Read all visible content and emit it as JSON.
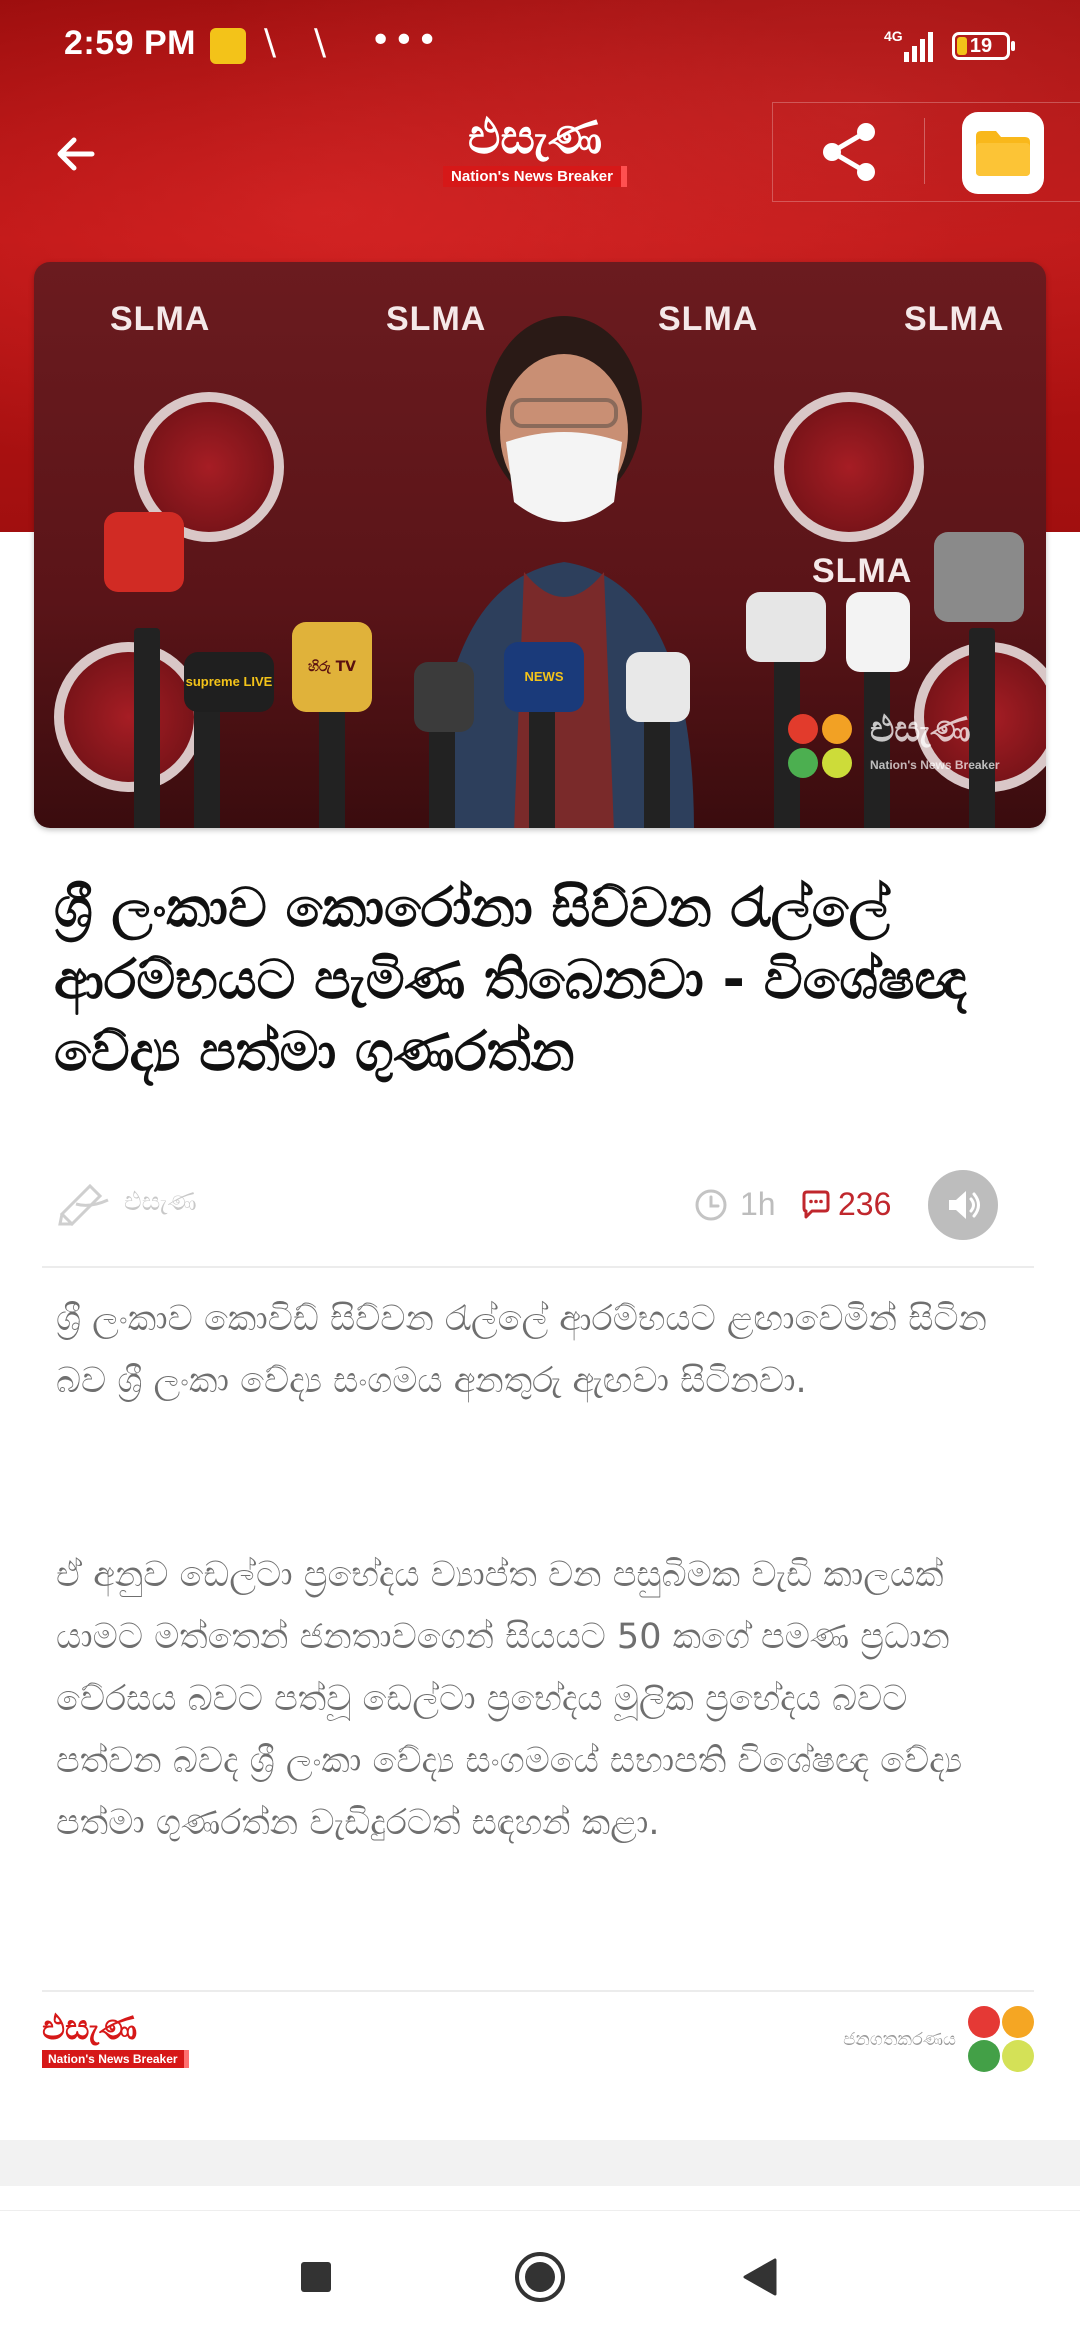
{
  "status_bar": {
    "time": "2:59 PM",
    "network": "4G",
    "battery": "19",
    "overflow": "•••"
  },
  "app": {
    "logo_text": "එසැණ",
    "logo_tagline": "Nation's News Breaker"
  },
  "article": {
    "title": "ශ්‍රී ලංකාව කොරෝනා සිව්වන රැල්ලේ ආරම්භයට පැමිණ තිබෙනවා - විශේෂඥ වේද්‍ය පත්මා ගුණරත්න",
    "author": "එසැණ",
    "time_ago": "1h",
    "comments": "236",
    "paragraphs": [
      "ශ්‍රී ලංකාව කොවිඩ් සිව්වන රැල්ලේ ආරම්භයට ළඟාවෙමින් සිටින බව ශ්‍රී ලංකා වේද්‍ය සංගමය අනතුරු ඇඟවා සිටිනවා.",
      "ඒ අනුව ඩෙල්ටා ප්‍රභේදය ව්‍යාප්ත වන පසුබිමක වැඩි කාලයක් යාමට මත්තෙන් ජනතාවගෙන් සියයට 50 කගේ පමණ ප්‍රධාන වේරසය බවට පත්වූ ඩෙල්ටා ප්‍රභේදය මූලික ප්‍රභේදය බවට පත්වන බවද ශ්‍රී ලංකා වේද්‍ය සංගමයේ සභාපති විශේෂඥ වේද්‍ය පත්මා ගුණරත්න වැඩිදුරටත් සඳහන් කළා."
    ]
  },
  "hero_image": {
    "banner_text": "SLMA",
    "mic_labels": [
      "supreme LIVE",
      "හිරු TV",
      "NEWS"
    ],
    "watermark_logo": "එසැණ",
    "watermark_tag": "Nation's News Breaker"
  },
  "footer": {
    "logo_text": "එසැණ",
    "logo_tagline": "Nation's News Breaker",
    "credit_label": "ජනගතකරණය"
  },
  "colors": {
    "brand_red": "#d61818",
    "header_red": "#b91414",
    "comment_red": "#c0272d",
    "files_yellow": "#f9b81b"
  },
  "icons": {
    "back": "arrow-left-icon",
    "share": "share-icon",
    "files": "folder-icon",
    "clock": "clock-icon",
    "comment": "comment-icon",
    "speaker": "speaker-icon",
    "author": "pen-icon"
  }
}
